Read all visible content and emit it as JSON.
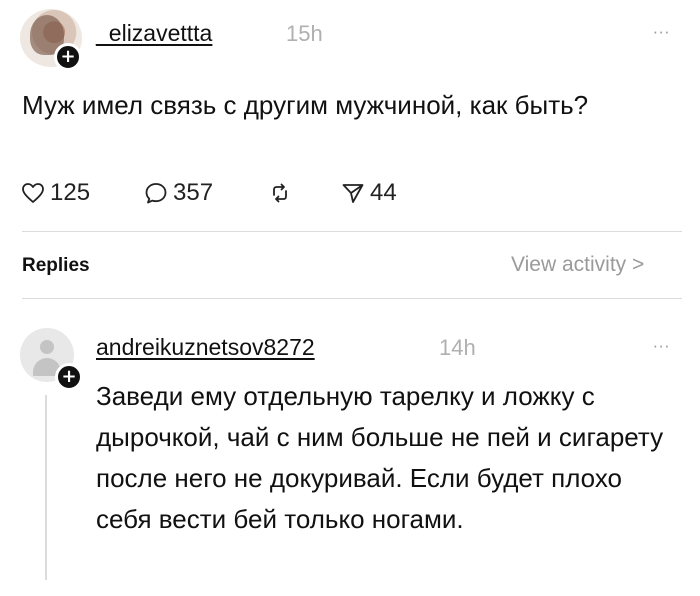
{
  "post": {
    "username": "_elizavettta",
    "time": "15h",
    "more": "···",
    "text": "Муж имел связь с другим мужчиной, как быть?",
    "actions": {
      "likes": "125",
      "comments": "357",
      "shares": "44"
    }
  },
  "replies_header": {
    "label": "Replies",
    "view_activity": "View activity >"
  },
  "reply": {
    "username": "andreikuznetsov8272",
    "time": "14h",
    "more": "···",
    "text": "Заведи ему отдельную тарелку и ложку с дырочкой, чай с ним больше не пей и сигарету после него не докуривай. Если будет плохо себя вести бей только ногами."
  },
  "icons": {
    "like": "heart-icon",
    "comment": "comment-icon",
    "repost": "repost-icon",
    "share": "send-icon",
    "follow": "plus-icon"
  },
  "colors": {
    "text": "#111111",
    "muted": "#9a9a9a",
    "divider": "#dcdcdc",
    "badge": "#111111"
  }
}
